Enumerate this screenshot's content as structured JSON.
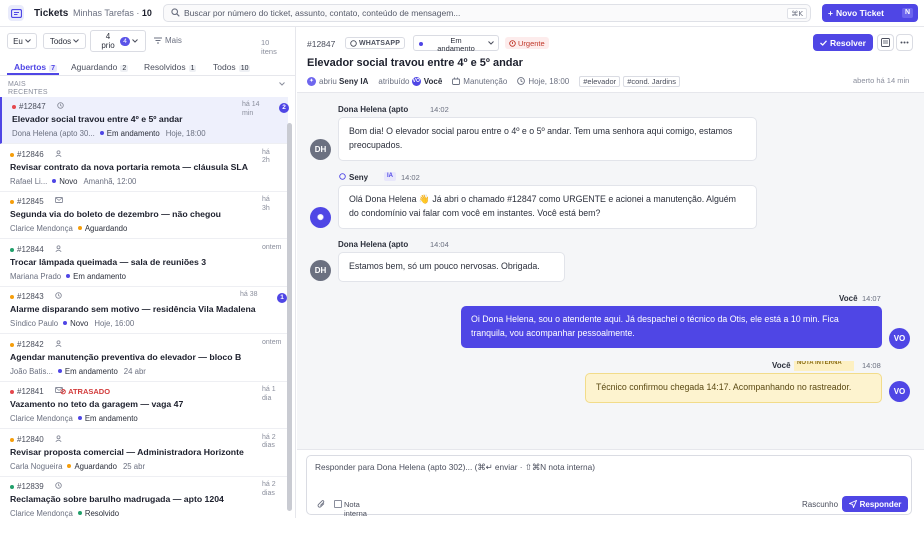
{
  "topbar": {
    "app_title": "Tickets",
    "my_tasks_label": "Minhas Tarefas",
    "my_tasks_count": "10",
    "search_placeholder": "Buscar por número do ticket, assunto, contato, conteúdo de mensagem...",
    "search_shortcut": "⌘K",
    "new_ticket_label": "Novo Ticket",
    "new_ticket_shortcut": "N"
  },
  "filters": {
    "owner": "Eu",
    "scope": "Todos",
    "priority_line1": "4",
    "priority_line2": "prio",
    "priority_badge": "4",
    "more_label": "Mais",
    "items_count_line1": "10",
    "items_count_line2": "itens"
  },
  "tabs": [
    {
      "label": "Abertos",
      "count": "7"
    },
    {
      "label": "Aguardando",
      "count": "2"
    },
    {
      "label": "Resolvidos",
      "count": "1"
    },
    {
      "label": "Todos",
      "count": "10"
    }
  ],
  "list_section": {
    "line1": "MAIS",
    "line2": "RECENTES"
  },
  "tickets": [
    {
      "id": "#12847",
      "channel_icon": "clock-icon",
      "subject": "Elevador social travou entre 4º e 5º andar",
      "contact": "Dona Helena (apto 30...",
      "status": "Em andamento",
      "status_color": "#4f46e5",
      "due": "Hoje, 18:00",
      "time_line1": "há 14",
      "time_line2": "min",
      "unread": "2",
      "priority_color": "#e5484d",
      "late_label": ""
    },
    {
      "id": "#12846",
      "channel_icon": "user-icon",
      "subject": "Revisar contrato da nova portaria remota — cláusula SLA",
      "contact": "Rafael Li...",
      "status": "Novo",
      "status_color": "#4f46e5",
      "due": "Amanhã, 12:00",
      "time_line1": "há",
      "time_line2": "2h",
      "unread": "",
      "priority_color": "#f59e0b",
      "late_label": ""
    },
    {
      "id": "#12845",
      "channel_icon": "mail-icon",
      "subject": "Segunda via do boleto de dezembro — não chegou",
      "contact": "Clarice Mendonça",
      "status": "Aguardando",
      "status_color": "#f59e0b",
      "due": "",
      "time_line1": "há",
      "time_line2": "3h",
      "unread": "",
      "priority_color": "#f59e0b",
      "late_label": ""
    },
    {
      "id": "#12844",
      "channel_icon": "user-icon",
      "subject": "Trocar lâmpada queimada — sala de reuniões 3",
      "contact": "Mariana Prado",
      "status": "Em andamento",
      "status_color": "#4f46e5",
      "due": "",
      "time_line1": "ontem",
      "time_line2": "",
      "unread": "",
      "priority_color": "#22a06b",
      "late_label": ""
    },
    {
      "id": "#12843",
      "channel_icon": "clock-icon",
      "subject": "Alarme disparando sem motivo — residência Vila Madalena",
      "contact": "Síndico Paulo",
      "status": "Novo",
      "status_color": "#4f46e5",
      "due": "Hoje, 16:00",
      "time_line1": "há 38",
      "time_line2": "",
      "unread": "1",
      "priority_color": "#f59e0b",
      "late_label": ""
    },
    {
      "id": "#12842",
      "channel_icon": "user-icon",
      "subject": "Agendar manutenção preventiva do elevador — bloco B",
      "contact": "João Batis...",
      "status": "Em andamento",
      "status_color": "#4f46e5",
      "due": "24 abr",
      "time_line1": "ontem",
      "time_line2": "",
      "unread": "",
      "priority_color": "#f59e0b",
      "late_label": ""
    },
    {
      "id": "#12841",
      "channel_icon": "mail-icon",
      "subject": "Vazamento no teto da garagem — vaga 47",
      "contact": "Clarice Mendonça",
      "status": "Em andamento",
      "status_color": "#4f46e5",
      "due": "",
      "time_line1": "há 1",
      "time_line2": "dia",
      "unread": "",
      "priority_color": "#e5484d",
      "late_label": "ATRASADO"
    },
    {
      "id": "#12840",
      "channel_icon": "user-icon",
      "subject": "Revisar proposta comercial — Administradora Horizonte",
      "contact": "Carla Nogueira",
      "status": "Aguardando",
      "status_color": "#f59e0b",
      "due": "25 abr",
      "time_line1": "há 2",
      "time_line2": "dias",
      "unread": "",
      "priority_color": "#f59e0b",
      "late_label": ""
    },
    {
      "id": "#12839",
      "channel_icon": "clock-icon",
      "subject": "Reclamação sobre barulho madrugada — apto 1204",
      "contact": "Clarice Mendonça",
      "status": "Resolvido",
      "status_color": "#22a06b",
      "due": "",
      "time_line1": "há 2",
      "time_line2": "dias",
      "unread": "",
      "priority_color": "#22a06b",
      "late_label": ""
    }
  ],
  "ticket": {
    "id": "#12847",
    "channel": "WHATSAPP",
    "status_line1": "Em",
    "status_line2": "andamento",
    "priority": "Urgente",
    "resolve_label": "Resolver",
    "subject": "Elevador social travou entre 4º e 5º andar",
    "opened_by_label": "abriu",
    "opened_by": "Seny IA",
    "assigned_label": "atribuído",
    "assignee_initials": "VO",
    "assignee": "Você",
    "team": "Manutenção",
    "due": "Hoje, 18:00",
    "tags": [
      "#elevador",
      "#cond. Jardins"
    ],
    "opened_ago": "aberto há 14 min"
  },
  "messages": [
    {
      "author": "Dona Helena (apto 302)",
      "time": "14:02",
      "initials": "DH",
      "text": "Bom dia! O elevador social parou entre o 4º e o 5º andar. Tem uma senhora aqui comigo, estamos preocupados."
    },
    {
      "author": "Seny",
      "ai_tag": "IA",
      "time": "14:02",
      "text": "Olá Dona Helena 👋 Já abri o chamado #12847 como URGENTE e acionei a manutenção. Alguém do condomínio vai falar com você em instantes. Você está bem?"
    },
    {
      "author": "Dona Helena (apto 302)",
      "time": "14:04",
      "initials": "DH",
      "text": "Estamos bem, só um pouco nervosas. Obrigada."
    },
    {
      "author": "Você",
      "time": "14:07",
      "initials": "VO",
      "text": "Oi Dona Helena, sou o atendente aqui. Já despachei o técnico da Otis, ele está a 10 min. Fica tranquila, vou acompanhar pessoalmente."
    },
    {
      "author": "Você",
      "note_tag": "NOTA INTERNA",
      "time": "14:08",
      "initials": "VO",
      "text": "Técnico confirmou chegada 14:17. Acompanhando no rastreador."
    }
  ],
  "composer": {
    "placeholder": "Responder para Dona Helena (apto 302)...  (⌘↵ enviar · ⇧⌘N nota interna)",
    "internal_note_line1": "Nota",
    "internal_note_line2": "interna",
    "draft_label": "Rascunho",
    "reply_label": "Responder"
  },
  "colors": {
    "accent": "#4f46e5",
    "urgent": "#c0392b",
    "note_bg": "#fdf3cf"
  }
}
